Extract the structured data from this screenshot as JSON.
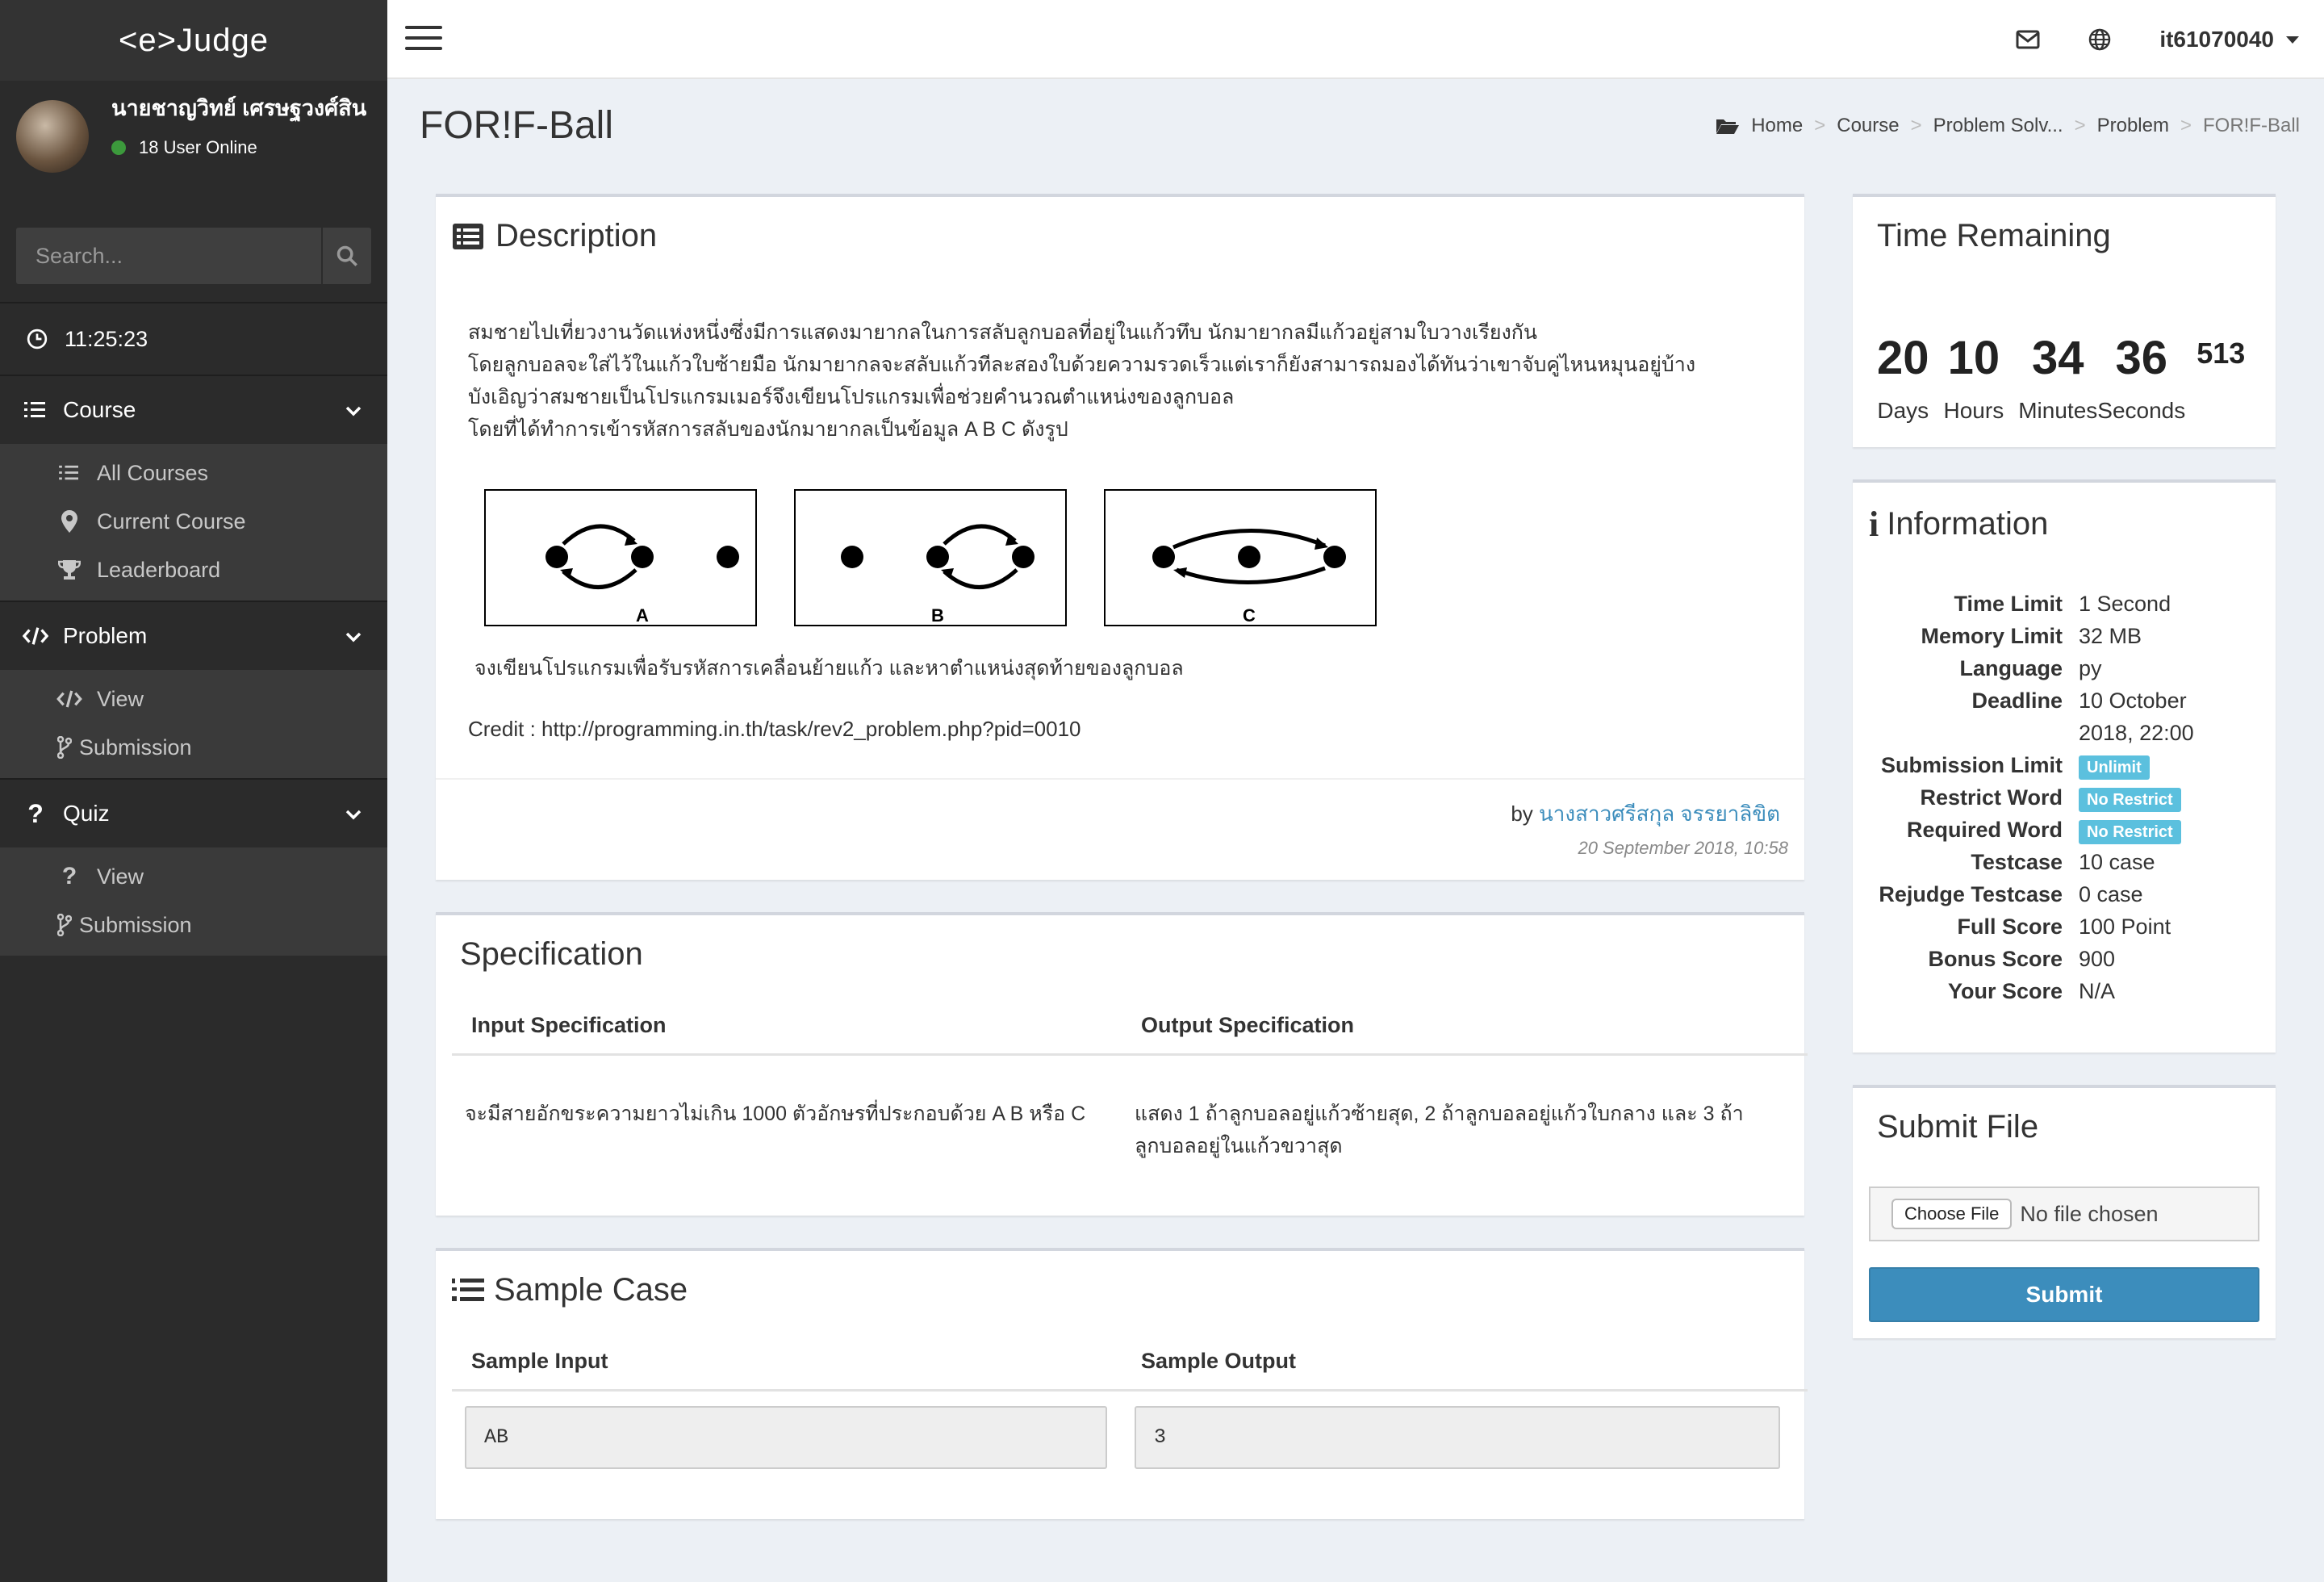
{
  "sidebar": {
    "brand": "<e>Judge",
    "user_name": "นายชาญวิทย์ เศรษฐวงศ์สิน",
    "online": "18 User Online",
    "search_placeholder": "Search...",
    "clock": "11:25:23",
    "course": {
      "label": "Course",
      "items": [
        "All Courses",
        "Current Course",
        "Leaderboard"
      ]
    },
    "problem": {
      "label": "Problem",
      "items": [
        "View",
        "Submission"
      ]
    },
    "quiz": {
      "label": "Quiz",
      "items": [
        "View",
        "Submission"
      ]
    }
  },
  "navbar": {
    "user": "it61070040"
  },
  "page": {
    "title": "FOR!F-Ball",
    "breadcrumb": [
      "Home",
      "Course",
      "Problem Solv...",
      "Problem",
      "FOR!F-Ball"
    ]
  },
  "description": {
    "title": "Description",
    "lines": [
      "สมชายไปเที่ยวงานวัดแห่งหนึ่งซึ่งมีการแสดงมายากลในการสลับลูกบอลที่อยู่ในแก้วทึบ นักมายากลมีแก้วอยู่สามใบวางเรียงกัน",
      "โดยลูกบอลจะใส่ไว้ในแก้วใบซ้ายมือ นักมายากลจะสลับแก้วทีละสองใบด้วยความรวดเร็วแต่เราก็ยังสามารถมองได้ทันว่าเขาจับคู่ไหนหมุนอยู่บ้าง",
      "บังเอิญว่าสมชายเป็นโปรแกรมเมอร์จึงเขียนโปรแกรมเพื่อช่วยคำนวณตำแหน่งของลูกบอล",
      "โดยที่ได้ทำการเข้ารหัสการสลับของนักมายากลเป็นข้อมูล A B C ดังรูป"
    ],
    "figure_labels": [
      "A",
      "B",
      "C"
    ],
    "line2": "จงเขียนโปรแกรมเพื่อรับรหัสการเคลื่อนย้ายแก้ว และหาตำแหน่งสุดท้ายของลูกบอล",
    "credit": "Credit : http://programming.in.th/task/rev2_problem.php?pid=0010",
    "by": "by",
    "author": "นางสาวศรีสกุล จรรยาลิขิต",
    "posted": "20 September 2018, 10:58"
  },
  "specification": {
    "title": "Specification",
    "input_header": "Input Specification",
    "output_header": "Output Specification",
    "input_text": "จะมีสายอักขระความยาวไม่เกิน 1000 ตัวอักษรที่ประกอบด้วย A B หรือ C",
    "output_text": "แสดง 1 ถ้าลูกบอลอยู่แก้วซ้ายสุด, 2 ถ้าลูกบอลอยู่แก้วใบกลาง และ 3 ถ้าลูกบอลอยู่ในแก้วขวาสุด"
  },
  "sample": {
    "title": "Sample Case",
    "input_header": "Sample Input",
    "output_header": "Sample Output",
    "input": "AB",
    "output": "3"
  },
  "timer": {
    "title": "Time Remaining",
    "days": "20",
    "hours": "10",
    "minutes": "34",
    "seconds": "36",
    "ms": "513",
    "days_label": "Days",
    "hours_label": "Hours",
    "minutes_label": "Minutes",
    "seconds_label": "Seconds"
  },
  "information": {
    "title": "Information",
    "rows": [
      {
        "label": "Time Limit",
        "value": "1 Second"
      },
      {
        "label": "Memory Limit",
        "value": "32 MB"
      },
      {
        "label": "Language",
        "value": "py"
      },
      {
        "label": "Deadline",
        "value": "10 October 2018, 22:00"
      },
      {
        "label": "Submission Limit",
        "value": "Unlimit",
        "badge": true
      },
      {
        "label": "Restrict Word",
        "value": "No Restrict",
        "badge": true
      },
      {
        "label": "Required Word",
        "value": "No Restrict",
        "badge": true
      },
      {
        "label": "Testcase",
        "value": "10 case"
      },
      {
        "label": "Rejudge Testcase",
        "value": "0 case"
      },
      {
        "label": "Full Score",
        "value": "100 Point"
      },
      {
        "label": "Bonus Score",
        "value": "900"
      },
      {
        "label": "Your Score",
        "value": "N/A"
      }
    ]
  },
  "submit": {
    "title": "Submit File",
    "choose": "Choose File",
    "no_file": "No file chosen",
    "button": "Submit"
  },
  "colors": {
    "accent": "#3c8dbc",
    "badge": "#5bc0de",
    "sidebar": "#2b2b2b"
  }
}
